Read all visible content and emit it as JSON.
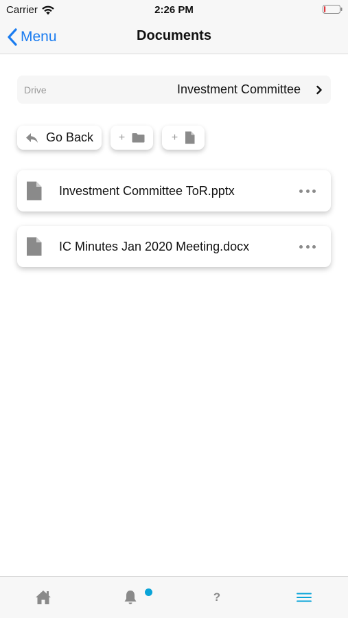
{
  "status_bar": {
    "carrier": "Carrier",
    "time": "2:26 PM",
    "battery_level": 0.1,
    "battery_color": "#e0383e"
  },
  "nav": {
    "back_label": "Menu",
    "title": "Documents",
    "accent_color": "#1a7cf0"
  },
  "drive": {
    "label": "Drive",
    "value": "Investment Committee",
    "icon": "chevron-right-icon"
  },
  "actions": {
    "go_back_label": "Go Back",
    "go_back_icon": "reply-icon",
    "add_folder_plus": "+",
    "add_folder_icon": "folder-icon",
    "add_file_plus": "+",
    "add_file_icon": "file-icon"
  },
  "files": [
    {
      "name": "Investment Committee ToR.pptx",
      "icon": "file-icon",
      "menu_icon": "more-icon"
    },
    {
      "name": "IC Minutes Jan 2020 Meeting.docx",
      "icon": "file-icon",
      "menu_icon": "more-icon"
    }
  ],
  "tab_bar": {
    "home_icon": "home-icon",
    "notifications_icon": "bell-icon",
    "notification_badge_color": "#0aa4d8",
    "help_label": "?",
    "menu_icon": "hamburger-icon",
    "active_color": "#0aa4d8"
  }
}
